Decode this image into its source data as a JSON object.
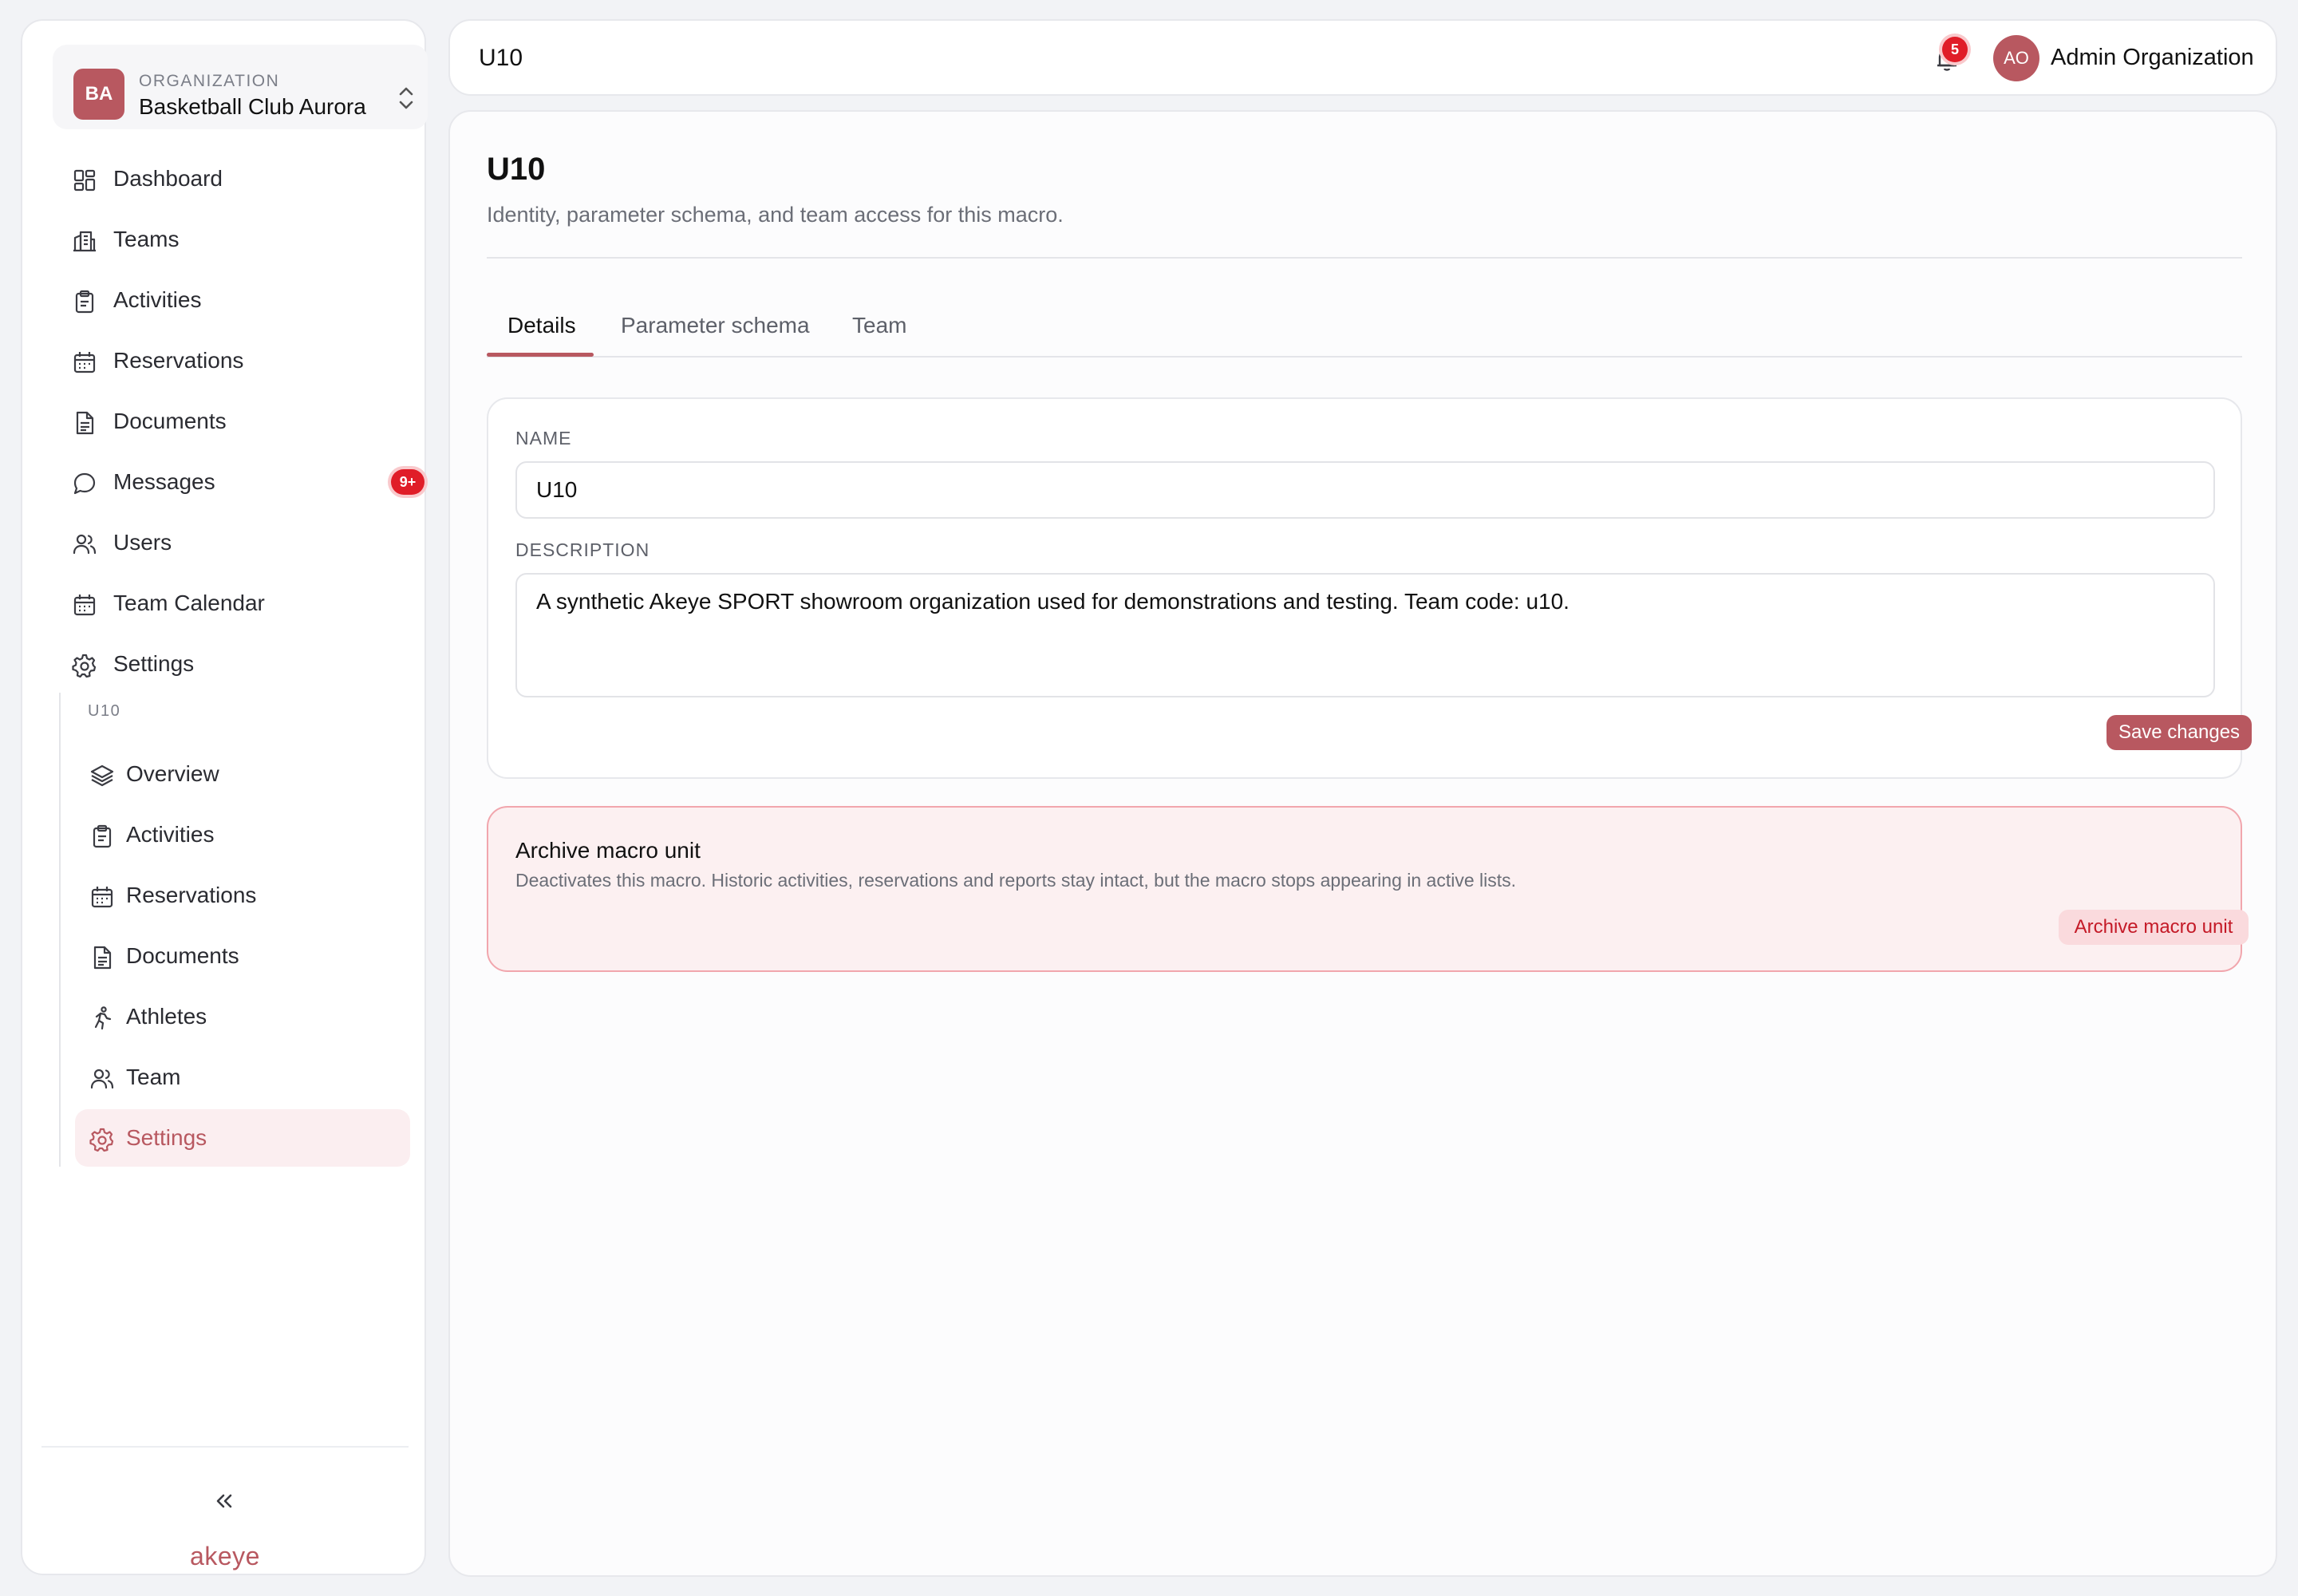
{
  "sidebar": {
    "org": {
      "initials": "BA",
      "kicker": "ORGANIZATION",
      "name": "Basketball Club Aurora",
      "switch_icon": "chevron-up-down-icon"
    },
    "items": [
      {
        "label": "Dashboard",
        "icon": "grid-icon"
      },
      {
        "label": "Teams",
        "icon": "building-icon"
      },
      {
        "label": "Activities",
        "icon": "clipboard-icon"
      },
      {
        "label": "Reservations",
        "icon": "calendar-icon"
      },
      {
        "label": "Documents",
        "icon": "document-icon"
      },
      {
        "label": "Messages",
        "icon": "chat-bubble-icon",
        "badge": "9+"
      },
      {
        "label": "Users",
        "icon": "users-icon"
      },
      {
        "label": "Team Calendar",
        "icon": "calendar-icon"
      },
      {
        "label": "Settings",
        "icon": "gear-icon"
      }
    ],
    "sub": {
      "title": "U10",
      "items": [
        {
          "label": "Overview",
          "icon": "layers-icon"
        },
        {
          "label": "Activities",
          "icon": "clipboard-icon"
        },
        {
          "label": "Reservations",
          "icon": "calendar-icon"
        },
        {
          "label": "Documents",
          "icon": "document-icon"
        },
        {
          "label": "Athletes",
          "icon": "running-person-icon"
        },
        {
          "label": "Team",
          "icon": "users-icon"
        },
        {
          "label": "Settings",
          "icon": "gear-icon",
          "active": true
        }
      ]
    },
    "collapse_icon": "double-chevron-left-icon",
    "brand": "akeye"
  },
  "topbar": {
    "title": "U10",
    "notifications": {
      "icon": "bell-icon",
      "count": "5"
    },
    "user": {
      "initials": "AO",
      "name": "Admin Organization"
    }
  },
  "main": {
    "title": "U10",
    "subtitle": "Identity, parameter schema, and team access for this macro.",
    "tabs": [
      {
        "label": "Details",
        "active": true
      },
      {
        "label": "Parameter schema"
      },
      {
        "label": "Team"
      }
    ],
    "form": {
      "name_label": "NAME",
      "name_value": "U10",
      "description_label": "DESCRIPTION",
      "description_value": "A synthetic Akeye SPORT showroom organization used for demonstrations and testing. Team code: u10.",
      "save_label": "Save changes"
    },
    "danger": {
      "title": "Archive macro unit",
      "description": "Deactivates this macro. Historic activities, reservations and reports stay intact, but the macro stops appearing in active lists.",
      "button_label": "Archive macro unit"
    }
  },
  "colors": {
    "accent": "#b85860",
    "badge": "#e01d28",
    "danger_bg": "#fcf0f1",
    "danger_border": "#f1a6ad"
  }
}
